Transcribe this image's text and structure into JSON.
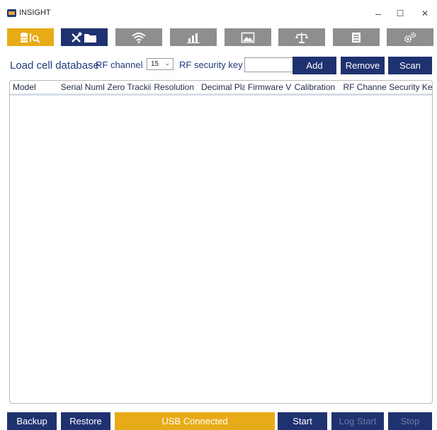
{
  "window": {
    "title": "INSIGHT",
    "controls": {
      "minimize": "–",
      "maximize": "☐",
      "close": "✕"
    }
  },
  "toolbar": {
    "tabs": [
      {
        "icon": "database-search-icon",
        "state": "active"
      },
      {
        "icon": "tools-folder-icon",
        "state": "selected"
      },
      {
        "icon": "wifi-icon",
        "state": "inactive"
      },
      {
        "icon": "bar-chart-icon",
        "state": "inactive"
      },
      {
        "icon": "image-icon",
        "state": "inactive"
      },
      {
        "icon": "scale-icon",
        "state": "inactive"
      },
      {
        "icon": "document-icon",
        "state": "inactive"
      },
      {
        "icon": "gears-icon",
        "state": "inactive"
      }
    ]
  },
  "controls": {
    "title": "Load cell database",
    "rf_channel_label": "RF channel",
    "rf_channel_value": "15",
    "rf_security_label": "RF security key",
    "rf_security_value": "",
    "add_label": "Add",
    "remove_label": "Remove",
    "scan_label": "Scan"
  },
  "table": {
    "columns": [
      "Model",
      "Serial Numl",
      "Zero Trackii",
      "Resolution",
      "Decimal Pla",
      "Firmware V",
      "Calibration",
      "RF Channel",
      "Security Ke"
    ],
    "rows": []
  },
  "footer": {
    "backup_label": "Backup",
    "restore_label": "Restore",
    "status": "USB Connected",
    "start_label": "Start",
    "log_start_label": "Log Start",
    "stop_label": "Stop"
  },
  "colors": {
    "navy": "#1f3270",
    "gold": "#e8ab18",
    "gray_tab": "#8e8e8e",
    "text_blue": "#1f3a7a"
  }
}
